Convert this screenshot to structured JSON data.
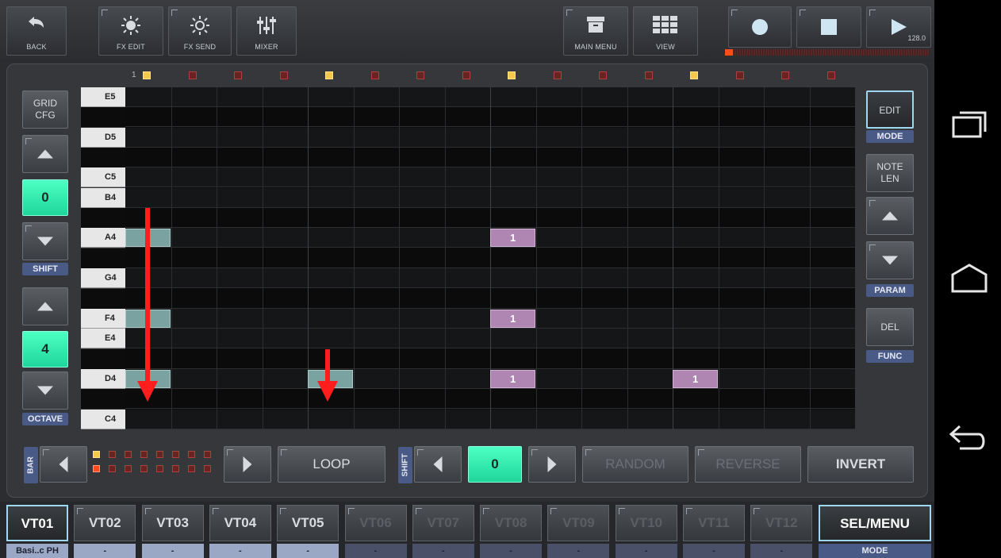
{
  "topbar": {
    "back": "BACK",
    "fx_edit": "FX EDIT",
    "fx_send": "FX SEND",
    "mixer": "MIXER",
    "main_menu": "MAIN MENU",
    "view": "VIEW",
    "tempo": "128.0",
    "progress": 0.04
  },
  "left": {
    "grid_cfg": "GRID\nCFG",
    "shift_value": "0",
    "shift_label": "SHIFT",
    "octave_value": "4",
    "octave_label": "OCTAVE"
  },
  "right": {
    "edit": "EDIT",
    "mode_label": "MODE",
    "note_len": "NOTE\nLEN",
    "param_label": "PARAM",
    "del": "DEL",
    "func_label": "FUNC"
  },
  "grid": {
    "first_step_label": "1",
    "active_step_markers": [
      1,
      5,
      9,
      13
    ],
    "keys": [
      "E5",
      "",
      "D5",
      "",
      "C5",
      "B4",
      "",
      "A4",
      "",
      "G4",
      "",
      "F4",
      "E4",
      "",
      "D4",
      "",
      "C4"
    ],
    "notes": [
      {
        "row": 7,
        "step": 1,
        "label": "",
        "color": "teal"
      },
      {
        "row": 7,
        "step": 9,
        "label": "1",
        "color": "violet"
      },
      {
        "row": 11,
        "step": 1,
        "label": "",
        "color": "teal"
      },
      {
        "row": 11,
        "step": 9,
        "label": "1",
        "color": "violet"
      },
      {
        "row": 14,
        "step": 1,
        "label": "",
        "color": "teal"
      },
      {
        "row": 14,
        "step": 5,
        "label": "",
        "color": "teal"
      },
      {
        "row": 14,
        "step": 9,
        "label": "1",
        "color": "violet"
      },
      {
        "row": 14,
        "step": 13,
        "label": "1",
        "color": "violet"
      }
    ]
  },
  "bottom": {
    "bar_label": "BAR",
    "loop": "LOOP",
    "shift_label": "SHIFT",
    "shift_value": "0",
    "random": "RANDOM",
    "reverse": "REVERSE",
    "invert": "INVERT"
  },
  "tracks": [
    {
      "label": "VT01",
      "name": "Basi..c PH",
      "state": "selected"
    },
    {
      "label": "VT02",
      "name": "-",
      "state": "active"
    },
    {
      "label": "VT03",
      "name": "-",
      "state": "active"
    },
    {
      "label": "VT04",
      "name": "-",
      "state": "active"
    },
    {
      "label": "VT05",
      "name": "-",
      "state": "active"
    },
    {
      "label": "VT06",
      "name": "-",
      "state": "off"
    },
    {
      "label": "VT07",
      "name": "-",
      "state": "off"
    },
    {
      "label": "VT08",
      "name": "-",
      "state": "off"
    },
    {
      "label": "VT09",
      "name": "-",
      "state": "off"
    },
    {
      "label": "VT10",
      "name": "-",
      "state": "off"
    },
    {
      "label": "VT11",
      "name": "-",
      "state": "off"
    },
    {
      "label": "VT12",
      "name": "-",
      "state": "off"
    }
  ],
  "sel_menu": {
    "label": "SEL/MENU",
    "sub": "MODE"
  },
  "colors": {
    "accent_green": "#2ee3a6",
    "note_teal": "#7aa2a0",
    "note_violet": "#ae86b1",
    "label_blue": "#4a5a86"
  }
}
